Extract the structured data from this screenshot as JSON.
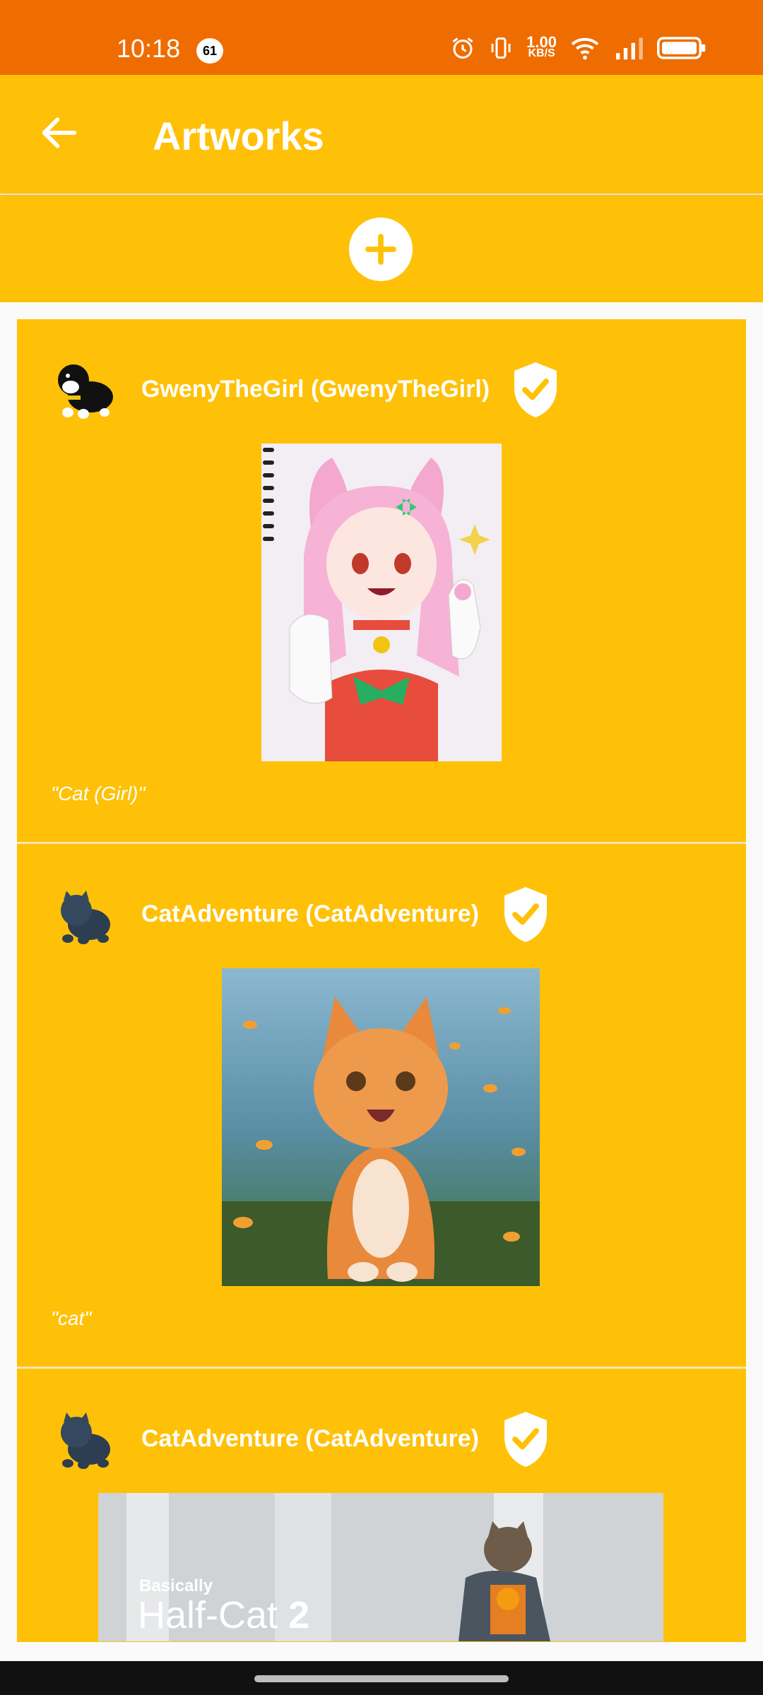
{
  "status_bar": {
    "time": "10:18",
    "notification_count": "61",
    "net_speed_value": "1.00",
    "net_speed_unit": "KB/S",
    "icons": [
      "alarm-icon",
      "vibrate-icon",
      "wifi-icon",
      "signal-icon",
      "battery-icon"
    ]
  },
  "app_bar": {
    "title": "Artworks",
    "back_icon": "arrow-back-icon"
  },
  "add_button": {
    "icon": "plus-icon"
  },
  "colors": {
    "status_bar": "#ef6c00",
    "primary": "#ffc107",
    "text_on_primary": "#ffffff"
  },
  "artworks": [
    {
      "username": "GwenyTheGirl (GwenyTheGirl)",
      "verified": true,
      "caption": "\"Cat (Girl)\""
    },
    {
      "username": "CatAdventure (CatAdventure)",
      "verified": true,
      "caption": "\"cat\""
    },
    {
      "username": "CatAdventure (CatAdventure)",
      "verified": true,
      "art_text_small": "Basically",
      "art_text_large": "Half-Cat",
      "art_text_number": "2"
    }
  ]
}
